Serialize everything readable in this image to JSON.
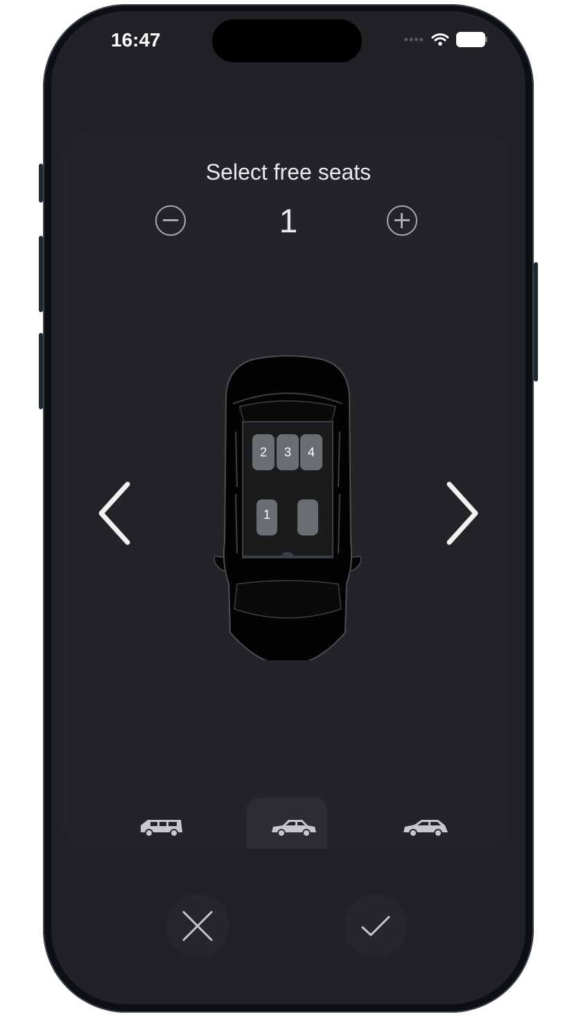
{
  "status_bar": {
    "time": "16:47"
  },
  "seat_selector": {
    "title": "Select free seats",
    "count": "1",
    "seats": [
      {
        "label": "2"
      },
      {
        "label": "3"
      },
      {
        "label": "4"
      },
      {
        "label": "1"
      }
    ]
  },
  "vehicle_types": [
    {
      "icon": "van-icon",
      "selected": false
    },
    {
      "icon": "sedan-icon",
      "selected": true
    },
    {
      "icon": "hatchback-icon",
      "selected": false
    }
  ],
  "colors": {
    "background": "#212126",
    "text": "#e9e9ee",
    "seat": "#6b6e70"
  }
}
